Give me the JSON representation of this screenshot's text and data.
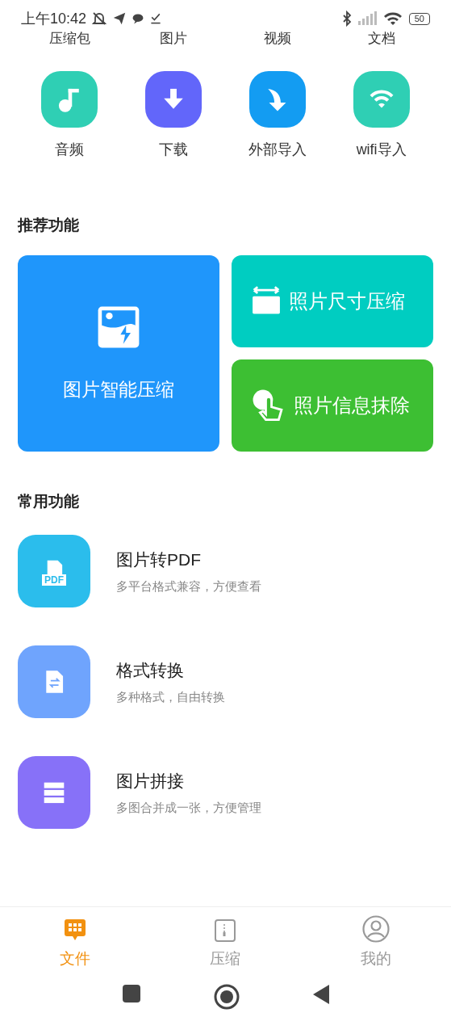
{
  "status_bar": {
    "time": "上午10:42",
    "battery": "50"
  },
  "top_categories": [
    {
      "label": "压缩包"
    },
    {
      "label": "图片"
    },
    {
      "label": "视频"
    },
    {
      "label": "文档"
    }
  ],
  "quick_actions": [
    {
      "label": "音频",
      "kind": "music",
      "color": "#2fcfb4"
    },
    {
      "label": "下载",
      "kind": "download",
      "color": "#6266fa"
    },
    {
      "label": "外部导入",
      "kind": "import",
      "color": "#139cf2"
    },
    {
      "label": "wifi导入",
      "kind": "wifi",
      "color": "#2fcfb4"
    }
  ],
  "recommended": {
    "title": "推荐功能",
    "main_card": {
      "label": "图片智能压缩",
      "kind": "compress",
      "color": "#1f96fb"
    },
    "cards": [
      {
        "label": "照片尺寸压缩",
        "kind": "resize",
        "color": "#00cdc1"
      },
      {
        "label": "照片信息抹除",
        "kind": "erase",
        "color": "#3dbf33"
      }
    ]
  },
  "common": {
    "title": "常用功能",
    "items": [
      {
        "title": "图片转PDF",
        "subtitle": "多平台格式兼容，方便查看",
        "kind": "pdf",
        "badge_text": "PDF",
        "color": "#2bbdec"
      },
      {
        "title": "格式转换",
        "subtitle": "多种格式，自由转换",
        "kind": "convert",
        "color": "#6fa4fd"
      },
      {
        "title": "图片拼接",
        "subtitle": "多图合并成一张，方便管理",
        "kind": "stack",
        "color": "#8771f8"
      }
    ]
  },
  "tabs": [
    {
      "label": "文件",
      "kind": "files",
      "selected": true
    },
    {
      "label": "压缩",
      "kind": "zip",
      "selected": false
    },
    {
      "label": "我的",
      "kind": "profile",
      "selected": false
    }
  ]
}
